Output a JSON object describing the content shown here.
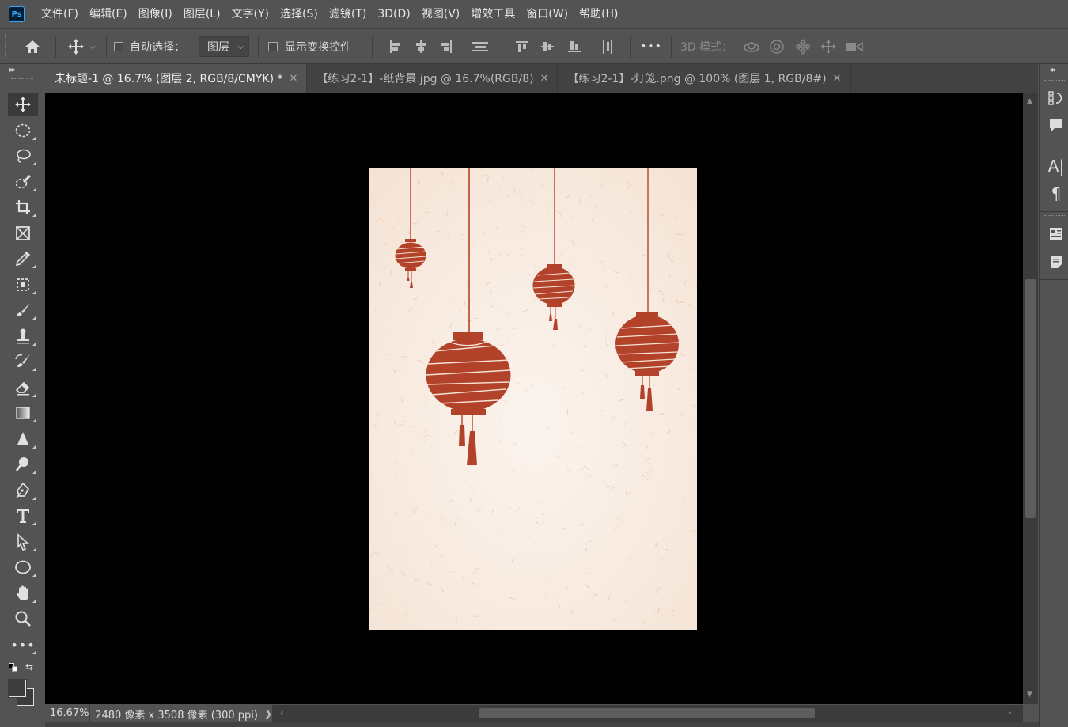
{
  "app": {
    "logo_text": "Ps",
    "menu": [
      "文件(F)",
      "编辑(E)",
      "图像(I)",
      "图层(L)",
      "文字(Y)",
      "选择(S)",
      "滤镜(T)",
      "3D(D)",
      "视图(V)",
      "增效工具",
      "窗口(W)",
      "帮助(H)"
    ]
  },
  "options_bar": {
    "auto_select_label": "自动选择：",
    "auto_select_checked": false,
    "auto_select_target": "图层",
    "show_transform_label": "显示变换控件",
    "show_transform_checked": false,
    "more_label": "•••",
    "mode_3d_label": "3D 模式："
  },
  "tabs": [
    {
      "label": "未标题-1 @ 16.7% (图层 2, RGB/8/CMYK) *",
      "active": true
    },
    {
      "label": "【练习2-1】-纸背景.jpg @ 16.7%(RGB/8)",
      "active": false
    },
    {
      "label": "【练习2-1】-灯笼.png @ 100% (图层 1, RGB/8#)",
      "active": false
    }
  ],
  "toolbar": {
    "tools": [
      "move-tool",
      "marquee-tool",
      "lasso-tool",
      "quick-selection-tool",
      "crop-tool",
      "frame-tool",
      "eyedropper-tool",
      "spot-healing-tool",
      "brush-tool",
      "clone-stamp-tool",
      "history-brush-tool",
      "eraser-tool",
      "gradient-tool",
      "blur-tool",
      "dodge-tool",
      "pen-tool",
      "type-tool",
      "path-selection-tool",
      "ellipse-tool",
      "hand-tool",
      "zoom-tool",
      "edit-toolbar"
    ],
    "active_tool": "move-tool",
    "foreground_color": "#3c3c3c",
    "background_color": "#3c3c3c"
  },
  "status": {
    "zoom": "16.67%",
    "doc_info": "2480 像素 x 3508 像素 (300 ppi)"
  },
  "canvas": {
    "paper_color": "#f8ebe1",
    "lantern_color": "#b2432a",
    "lanterns": [
      {
        "name": "lantern-small-left",
        "size": "small"
      },
      {
        "name": "lantern-large-center",
        "size": "large"
      },
      {
        "name": "lantern-small-center-right",
        "size": "small"
      },
      {
        "name": "lantern-medium-right",
        "size": "medium"
      }
    ]
  },
  "right_dock": {
    "icons": [
      "history-icon",
      "comments-icon",
      "character-icon",
      "paragraph-icon",
      "properties-icon",
      "notes-icon"
    ]
  }
}
